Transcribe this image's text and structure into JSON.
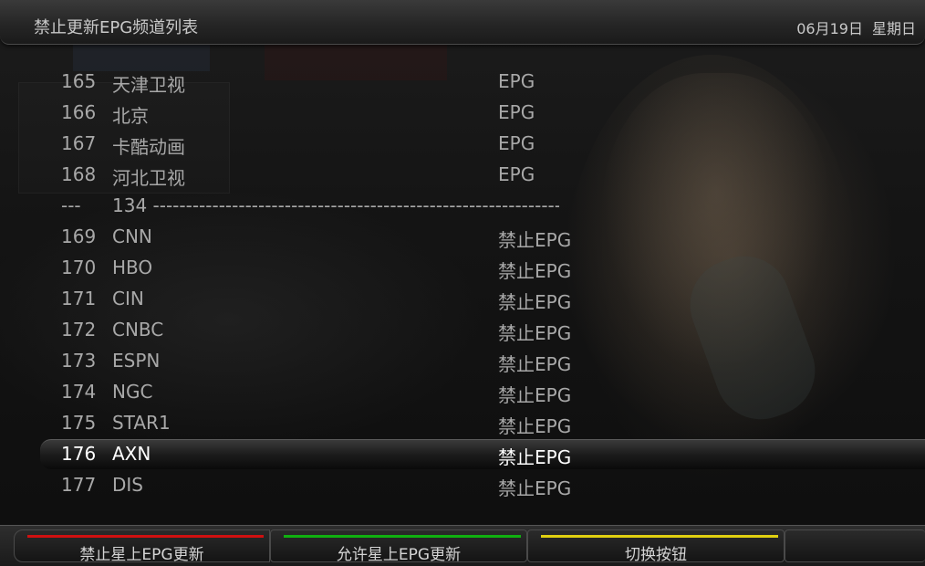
{
  "header": {
    "title": "禁止更新EPG频道列表",
    "date": "06月19日",
    "weekday": "星期日"
  },
  "channels": [
    {
      "num": "165",
      "name": "天津卫视",
      "status": "EPG"
    },
    {
      "num": "166",
      "name": "北京",
      "status": "EPG"
    },
    {
      "num": "167",
      "name": "卡酷动画",
      "status": "EPG"
    },
    {
      "num": "168",
      "name": "河北卫视",
      "status": "EPG"
    },
    {
      "num": "---",
      "name": "134 ------------------------------------------------------------------",
      "status": ""
    },
    {
      "num": "169",
      "name": "CNN",
      "status": "禁止EPG"
    },
    {
      "num": "170",
      "name": "HBO",
      "status": "禁止EPG"
    },
    {
      "num": "171",
      "name": "CIN",
      "status": "禁止EPG"
    },
    {
      "num": "172",
      "name": "CNBC",
      "status": "禁止EPG"
    },
    {
      "num": "173",
      "name": "ESPN",
      "status": "禁止EPG"
    },
    {
      "num": "174",
      "name": "NGC",
      "status": "禁止EPG"
    },
    {
      "num": "175",
      "name": "STAR1",
      "status": "禁止EPG"
    },
    {
      "num": "176",
      "name": "AXN",
      "status": "禁止EPG"
    },
    {
      "num": "177",
      "name": "DIS",
      "status": "禁止EPG"
    }
  ],
  "selected_index": 12,
  "footer": {
    "red": {
      "label": "禁止星上EPG更新",
      "color": "#d01010"
    },
    "green": {
      "label": "允许星上EPG更新",
      "color": "#10b010"
    },
    "yellow": {
      "label": "切换按钮",
      "color": "#e0d010"
    }
  }
}
